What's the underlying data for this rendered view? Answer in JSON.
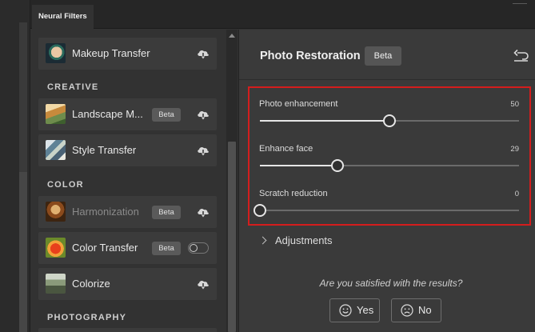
{
  "tabs": {
    "active": "Neural Filters"
  },
  "filters": {
    "featured": [
      {
        "name": "Makeup Transfer",
        "badge": "",
        "control": "cloud-download-icon",
        "enabled": true
      }
    ],
    "creative": {
      "heading": "CREATIVE",
      "items": [
        {
          "name": "Landscape M...",
          "badge": "Beta",
          "control": "cloud-download-icon",
          "enabled": true
        },
        {
          "name": "Style Transfer",
          "badge": "",
          "control": "cloud-download-icon",
          "enabled": true
        }
      ]
    },
    "color": {
      "heading": "COLOR",
      "items": [
        {
          "name": "Harmonization",
          "badge": "Beta",
          "control": "cloud-download-icon",
          "enabled": false
        },
        {
          "name": "Color Transfer",
          "badge": "Beta",
          "control": "toggle",
          "enabled": true
        },
        {
          "name": "Colorize",
          "badge": "",
          "control": "cloud-download-icon",
          "enabled": true
        }
      ]
    },
    "photography": {
      "heading": "PHOTOGRAPHY"
    }
  },
  "panel": {
    "title": "Photo Restoration",
    "badge": "Beta",
    "reset_icon": "undo-icon",
    "sliders": [
      {
        "label": "Photo enhancement",
        "value": "50",
        "fraction": 0.5
      },
      {
        "label": "Enhance face",
        "value": "29",
        "fraction": 0.3
      },
      {
        "label": "Scratch reduction",
        "value": "0",
        "fraction": 0.0
      }
    ],
    "adjustments_label": "Adjustments",
    "feedback": {
      "question": "Are you satisfied with the results?",
      "yes_label": "Yes",
      "no_label": "No"
    }
  },
  "colors": {
    "highlight_border": "#d41d1d",
    "background": "#323232",
    "panel": "#3a3a3a",
    "item": "#3b3b3b"
  }
}
